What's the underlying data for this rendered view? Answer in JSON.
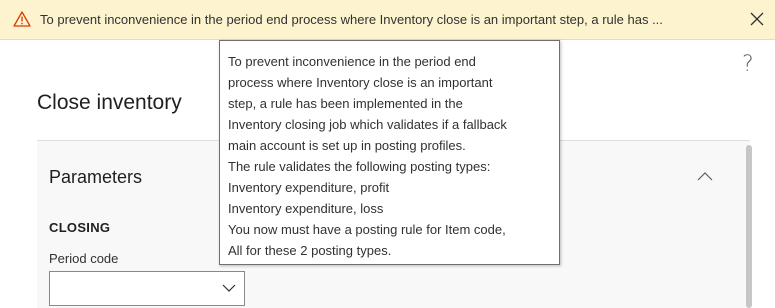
{
  "banner": {
    "icon": "warning-icon",
    "message": "To prevent inconvenience in the period end process where Inventory close is an important step, a rule has ...",
    "close_icon": "close-icon",
    "accent_color": "#d83b01"
  },
  "help": {
    "label": "?"
  },
  "dialog": {
    "title": "Close inventory"
  },
  "panel": {
    "title": "Parameters",
    "section": "CLOSING",
    "period_code_label": "Period code",
    "period_code_value": ""
  },
  "tooltip": {
    "lines": [
      "To prevent inconvenience in the period end",
      "process where Inventory close is an important",
      "step, a rule has been implemented in the",
      "Inventory closing job which validates if a fallback",
      "main account is set up in posting profiles.",
      "The rule validates the following posting types:",
      "Inventory expenditure, profit",
      "Inventory expenditure, loss",
      "You now must have a posting rule for Item code,",
      "All for these 2 posting types."
    ]
  }
}
